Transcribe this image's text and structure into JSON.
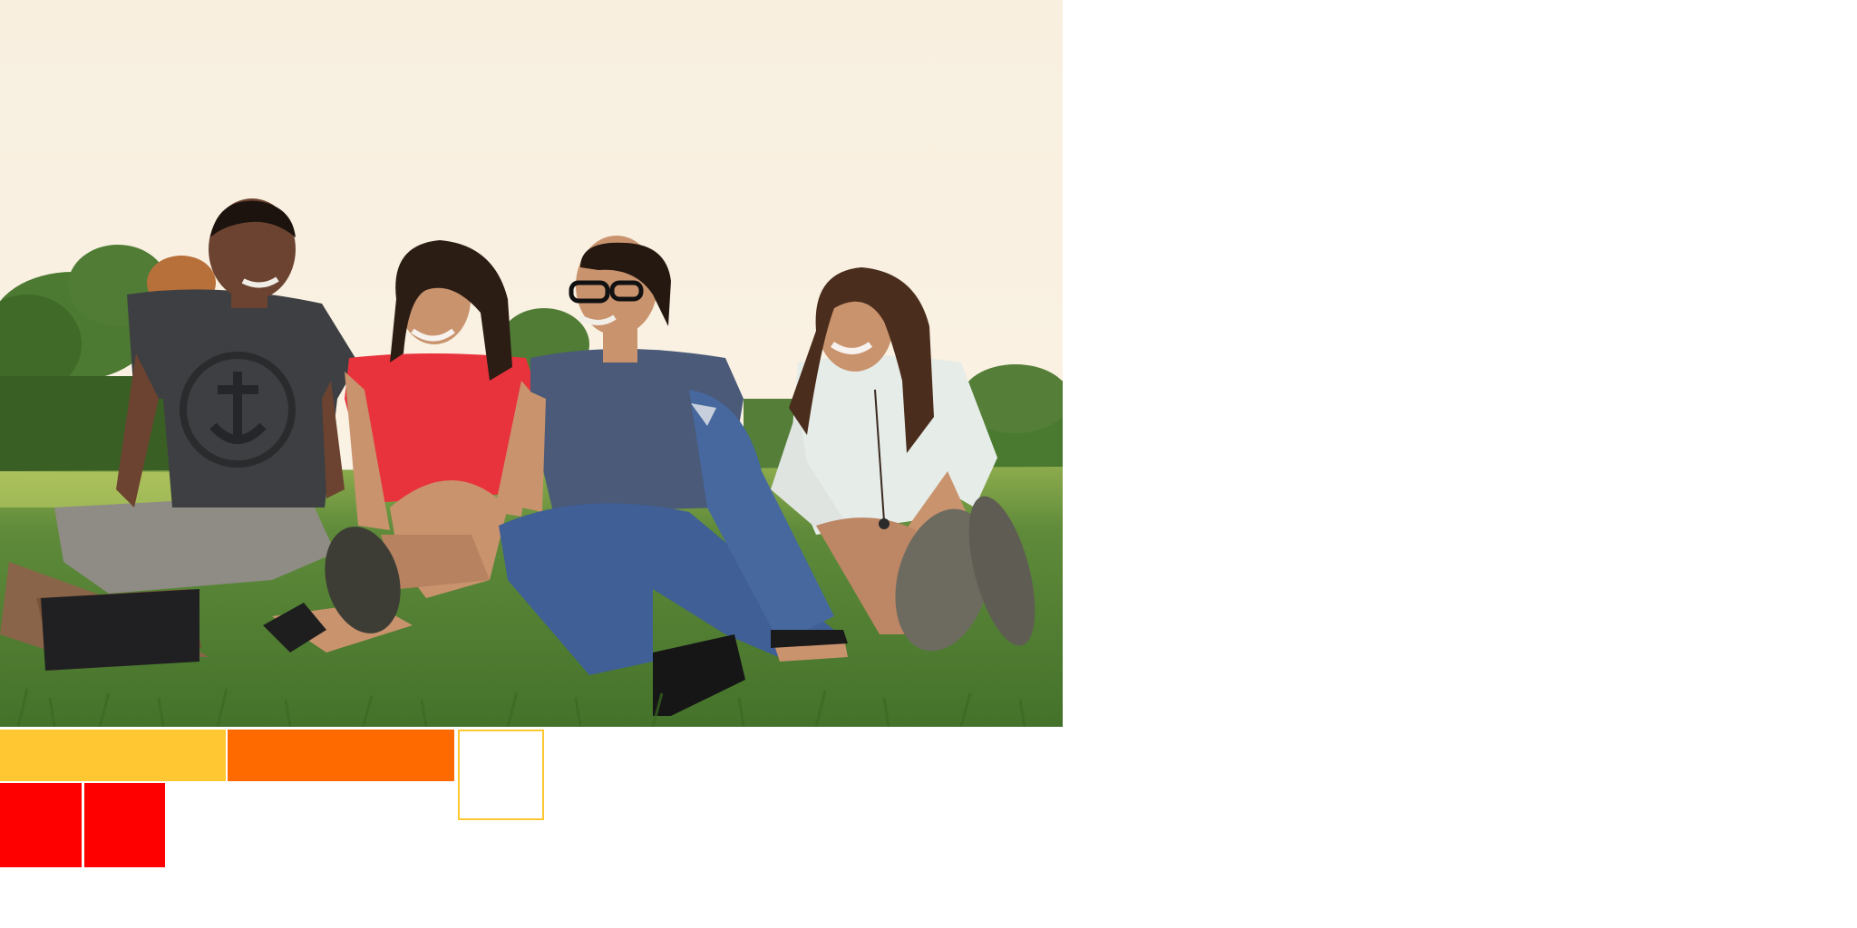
{
  "photo": {
    "subject": "friends-sitting-on-grass"
  },
  "tiles": {
    "colors": {
      "yellow": "#ffc832",
      "orange": "#ff6a00",
      "outline": "#ffc832",
      "red": "#ff0000"
    }
  },
  "palette": {
    "sky": "#f8efdf",
    "grass": "#5e8a3a",
    "grass_dark": "#3f6a28",
    "trees": "#4c7a32",
    "skin": "#c9936e",
    "skin_dark": "#6b4330",
    "shirt_gray": "#3d3f42",
    "shirt_red": "#e8323c",
    "shirt_blue": "#4a5a78",
    "jeans": "#3f5f96",
    "shirt_white": "#e6ece8",
    "hair": "#2c1d14"
  }
}
